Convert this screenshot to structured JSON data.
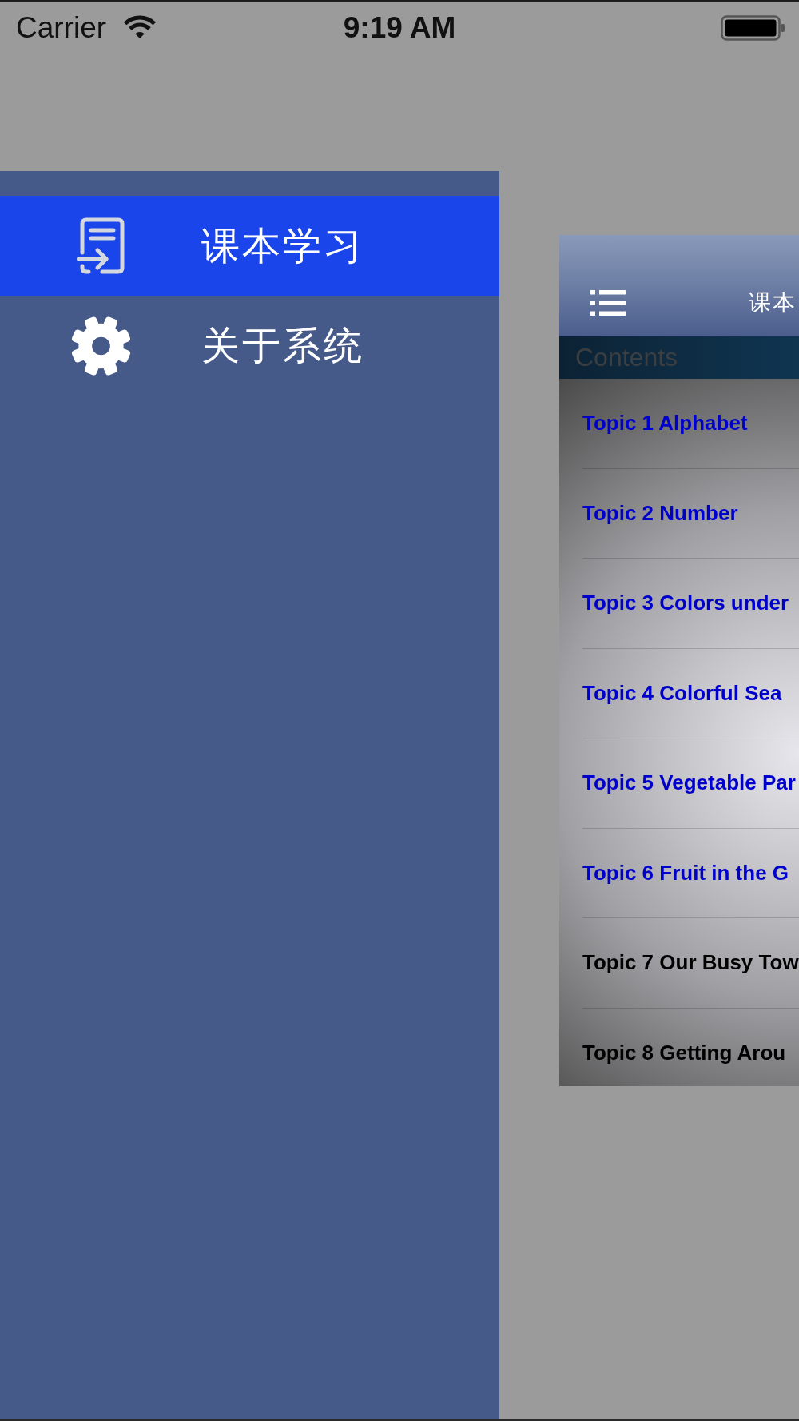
{
  "status_bar": {
    "carrier": "Carrier",
    "time": "9:19 AM"
  },
  "sidebar": {
    "items": [
      {
        "kind": "study",
        "label": "课本学习",
        "selected": true
      },
      {
        "kind": "about",
        "label": "关于系统",
        "selected": false
      }
    ]
  },
  "content_panel": {
    "title": "课本",
    "section_header": "Contents",
    "topics": [
      {
        "label": "Topic 1 Alphabet",
        "color": "#0000cc"
      },
      {
        "label": "Topic 2 Number",
        "color": "#0000cc"
      },
      {
        "label": "Topic 3 Colors under",
        "color": "#0000cc"
      },
      {
        "label": "Topic 4 Colorful Sea",
        "color": "#0000cc"
      },
      {
        "label": "Topic 5 Vegetable Par",
        "color": "#0000cc"
      },
      {
        "label": "Topic 6 Fruit in the G",
        "color": "#0000cc"
      },
      {
        "label": "Topic 7 Our Busy Tow",
        "color": "#000000"
      },
      {
        "label": "Topic 8 Getting Arou",
        "color": "#000000"
      }
    ]
  }
}
